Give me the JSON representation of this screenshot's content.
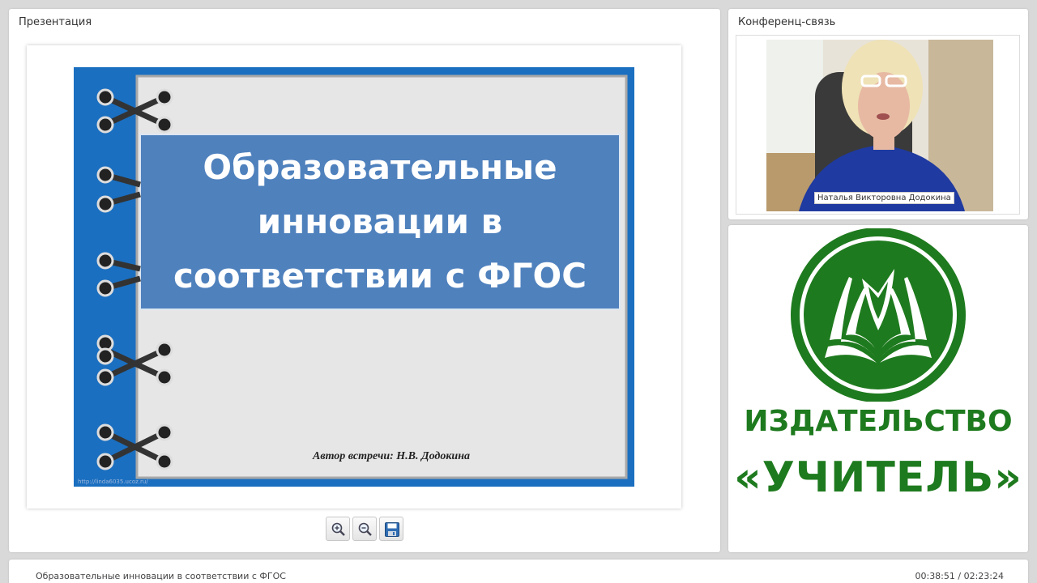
{
  "presentation": {
    "title": "Презентация",
    "slide": {
      "heading_line1": "Образовательные",
      "heading_line2": "инновации в",
      "heading_line3": "соответствии с ФГОС",
      "author": "Автор встречи: Н.В. Додокина",
      "url": "http://linda6035.ucoz.ru/"
    },
    "toolbar": {
      "zoom_in_icon": "zoom-in-icon",
      "zoom_out_icon": "zoom-out-icon",
      "save_icon": "floppy-disk-icon"
    }
  },
  "conference": {
    "title": "Конференц-связь",
    "speaker_name": "Наталья Викторовна Додокина"
  },
  "publisher": {
    "line1": "ИЗДАТЕЛЬСТВО",
    "line2": "«УЧИТЕЛЬ»",
    "brand_color": "#1e7a1e"
  },
  "bottom_bar": {
    "title": "Образовательные инновации в соответствии с ФГОС",
    "time": "00:38:51 / 02:23:24"
  },
  "colors": {
    "slide_blue": "#1b6fc0",
    "slide_title_box": "#4f81bd",
    "slide_paper": "#e6e6e6"
  }
}
